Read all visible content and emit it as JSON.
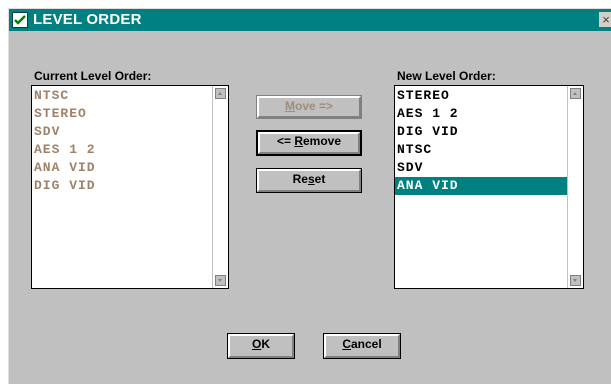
{
  "window": {
    "title": "LEVEL ORDER",
    "close_glyph": "×"
  },
  "current_list": {
    "label": "Current Level Order:",
    "items": [
      "NTSC",
      "STEREO",
      "SDV",
      "AES 1 2",
      "ANA VID",
      "DIG VID"
    ]
  },
  "new_list": {
    "label": "New Level Order:",
    "items": [
      "STEREO",
      "AES 1 2",
      "DIG VID",
      "NTSC",
      "SDV",
      "ANA VID"
    ],
    "selected_index": 5
  },
  "buttons": {
    "move": {
      "mnemonic": "M",
      "rest": "ove =>",
      "enabled": false
    },
    "remove": {
      "prefix": "<= ",
      "mnemonic": "R",
      "rest": "emove",
      "focused": true
    },
    "reset": {
      "prefix": "Re",
      "mnemonic": "s",
      "rest": "et"
    },
    "ok": {
      "mnemonic": "O",
      "rest": "K"
    },
    "cancel": {
      "mnemonic": "C",
      "rest": "ancel"
    }
  },
  "colors": {
    "titlebar": "#008080",
    "dialog_bg": "#c0c0c0",
    "selection": "#008080",
    "dim_text": "#a0826a"
  },
  "icons": {
    "title": "app-check-icon",
    "close": "close-icon",
    "scroll_up": "scroll-up-arrow-icon",
    "scroll_down": "scroll-down-arrow-icon"
  }
}
